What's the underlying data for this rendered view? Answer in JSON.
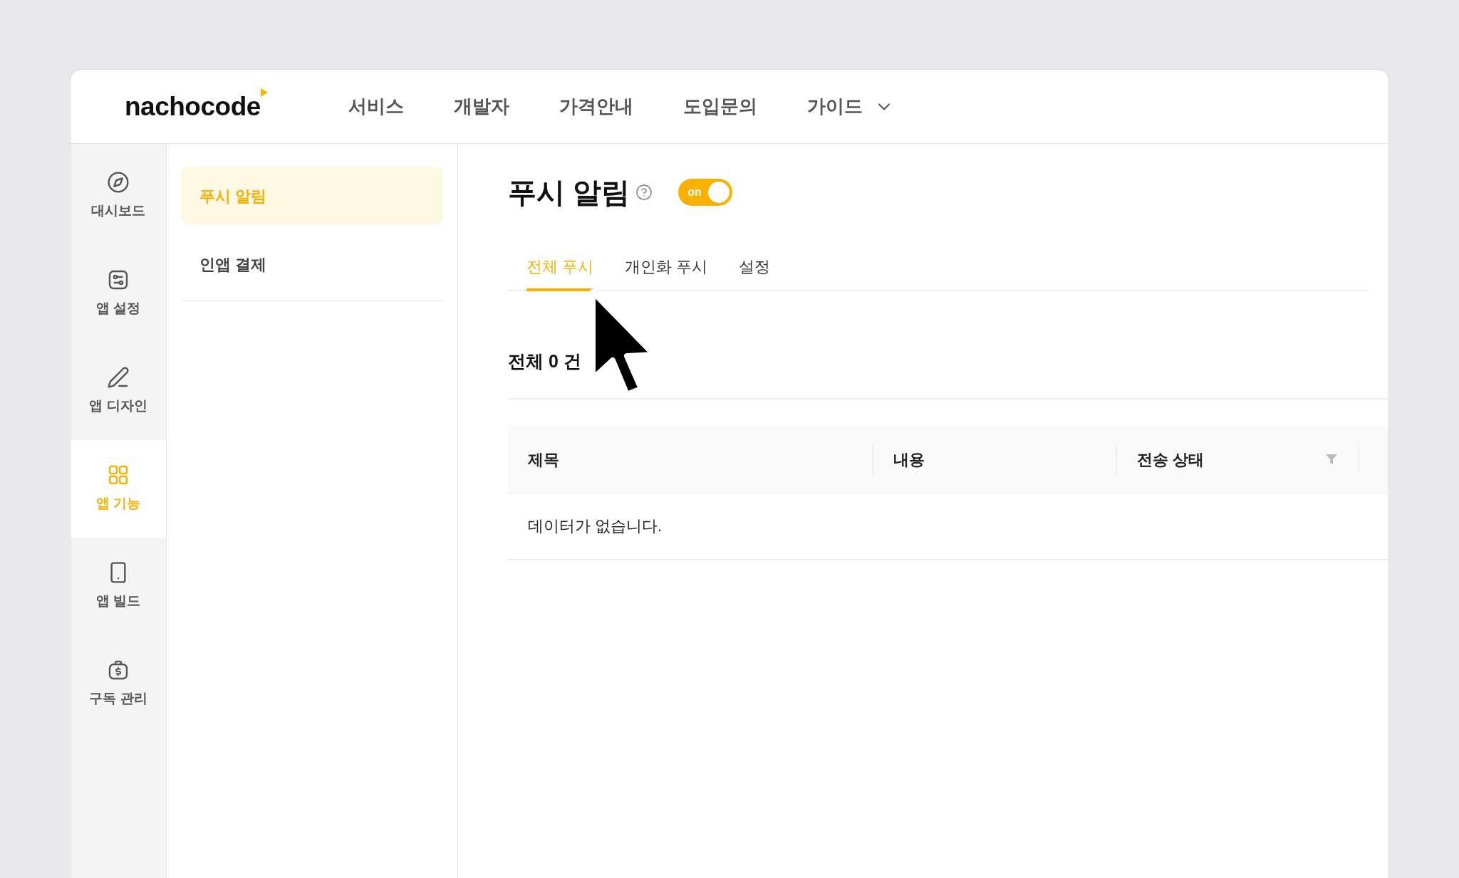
{
  "header": {
    "logo": "nachocode",
    "nav": [
      {
        "label": "서비스",
        "has_menu": false
      },
      {
        "label": "개발자",
        "has_menu": false
      },
      {
        "label": "가격안내",
        "has_menu": false
      },
      {
        "label": "도입문의",
        "has_menu": false
      },
      {
        "label": "가이드",
        "has_menu": true
      }
    ]
  },
  "sidebar": {
    "items": [
      {
        "label": "대시보드",
        "selected": false
      },
      {
        "label": "앱 설정",
        "selected": false
      },
      {
        "label": "앱 디자인",
        "selected": false
      },
      {
        "label": "앱 기능",
        "selected": true
      },
      {
        "label": "앱 빌드",
        "selected": false
      },
      {
        "label": "구독 관리",
        "selected": false
      }
    ]
  },
  "submenu": {
    "items": [
      {
        "label": "푸시 알림",
        "selected": true
      },
      {
        "label": "인앱 결제",
        "selected": false
      }
    ]
  },
  "page": {
    "title": "푸시 알림",
    "toggle": {
      "label": "on",
      "on": true
    },
    "tabs": [
      {
        "label": "전체 푸시",
        "selected": true
      },
      {
        "label": "개인화 푸시",
        "selected": false
      },
      {
        "label": "설정",
        "selected": false
      }
    ],
    "count": "전체 0 건",
    "table": {
      "columns": [
        {
          "label": "제목",
          "filter": false
        },
        {
          "label": "내용",
          "filter": false
        },
        {
          "label": "전송 상태",
          "filter": true
        }
      ],
      "empty_text": "데이터가 없습니다."
    }
  }
}
